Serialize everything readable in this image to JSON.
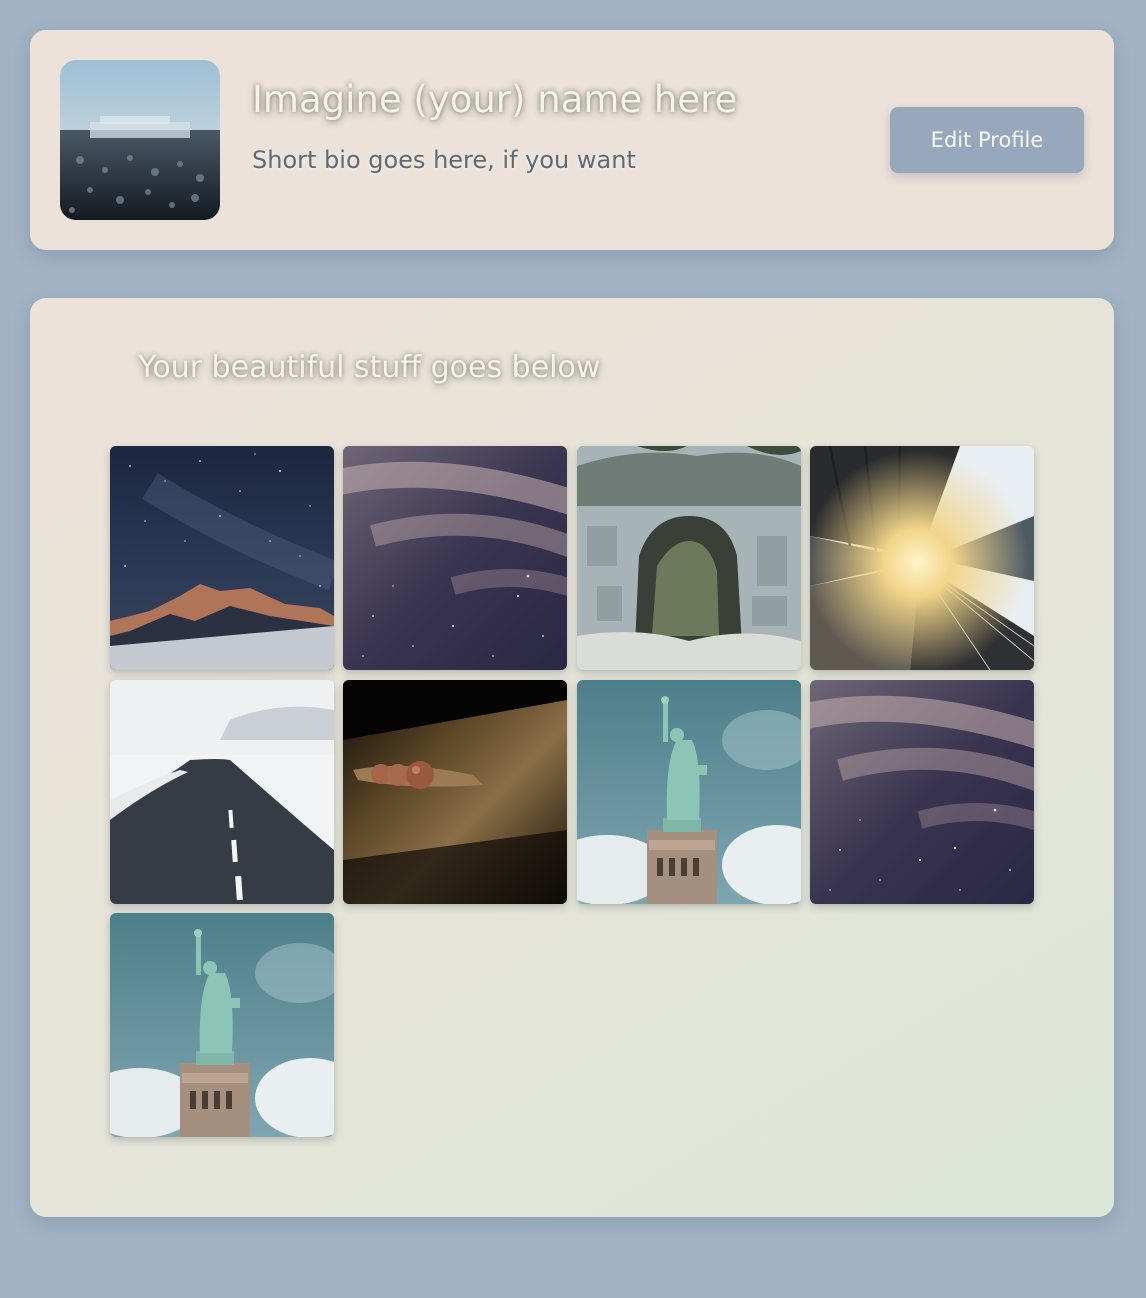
{
  "profile": {
    "avatar_icon": "city-skyline-photo",
    "name": "Imagine (your) name here",
    "bio": "Short bio goes here, if you want",
    "edit_button_label": "Edit Profile"
  },
  "gallery": {
    "heading": "Your beautiful stuff goes below",
    "photos": [
      {
        "icon": "night-sky-mountain-photo"
      },
      {
        "icon": "starry-sky-clouds-photo"
      },
      {
        "icon": "rock-arch-photo"
      },
      {
        "icon": "train-platform-sunset-photo"
      },
      {
        "icon": "snowy-road-photo"
      },
      {
        "icon": "seed-pods-on-wood-photo"
      },
      {
        "icon": "statue-of-liberty-photo"
      },
      {
        "icon": "starry-sky-clouds-photo"
      },
      {
        "icon": "statue-of-liberty-photo"
      }
    ]
  },
  "colors": {
    "page_background": "#a1b2c4",
    "card_background": "#ece2d9",
    "button_background": "#97a8bd",
    "bio_text": "#5e6a74"
  }
}
